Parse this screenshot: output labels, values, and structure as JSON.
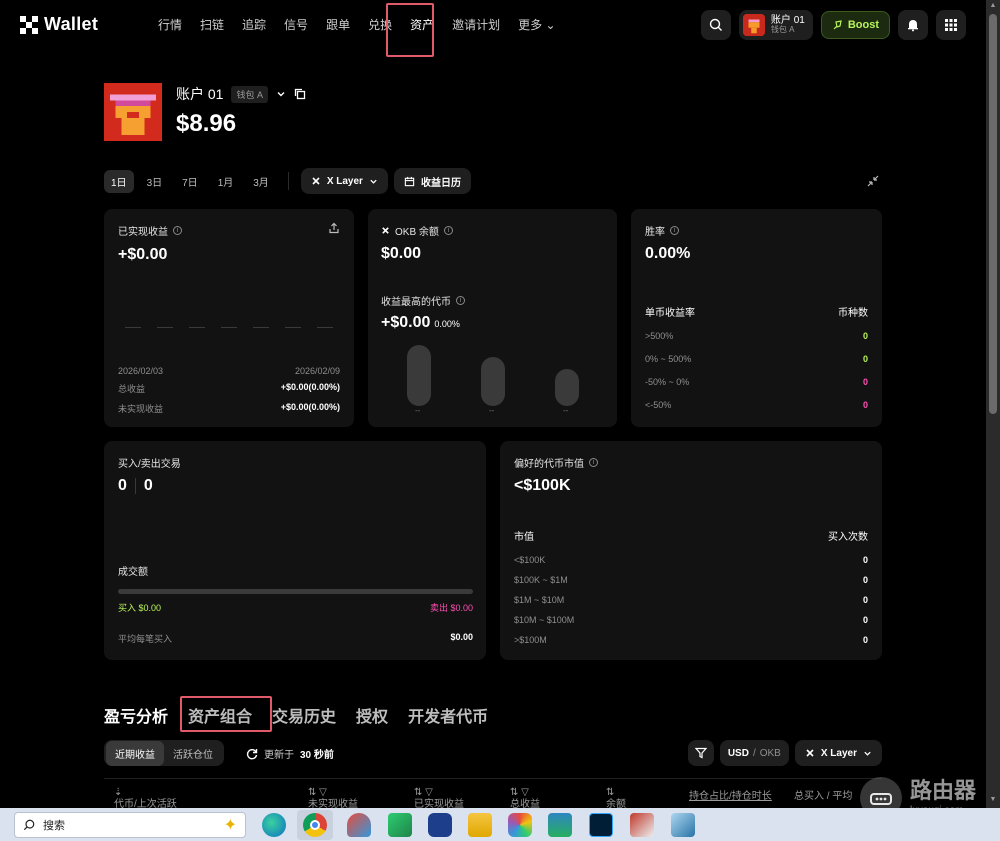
{
  "header": {
    "brand": "Wallet",
    "nav": [
      "行情",
      "扫链",
      "追踪",
      "信号",
      "跟单",
      "兑换",
      "资产",
      "邀请计划",
      "更多"
    ],
    "active_nav_index": 6,
    "account_chip": {
      "name": "账户 01",
      "wallet": "钱包 A"
    },
    "boost_label": "Boost"
  },
  "account": {
    "name": "账户 01",
    "wallet_tag": "钱包 A",
    "balance": "$8.96"
  },
  "period_row": {
    "periods": [
      "1日",
      "3日",
      "7日",
      "1月",
      "3月"
    ],
    "active_period_index": 0,
    "network": "X Layer",
    "calendar_label": "收益日历"
  },
  "cards": {
    "realized": {
      "title": "已实现收益",
      "value": "+$0.00",
      "date_start": "2026/02/03",
      "date_end": "2026/02/09",
      "total_label": "总收益",
      "total_value": "+$0.00(0.00%)",
      "unrealized_label": "未实现收益",
      "unrealized_value": "+$0.00(0.00%)"
    },
    "okb": {
      "title": "OKB 余额",
      "value": "$0.00",
      "top_title": "收益最高的代币",
      "top_value": "+$0.00",
      "top_pct": "0.00%",
      "cap_labels": [
        "--",
        "--",
        "--"
      ]
    },
    "winrate": {
      "title": "胜率",
      "value": "0.00%",
      "col_left": "单币收益率",
      "col_right": "币种数",
      "rows": [
        {
          "label": ">500%",
          "value": "0",
          "tone": "green"
        },
        {
          "label": "0% ~ 500%",
          "value": "0",
          "tone": "green"
        },
        {
          "label": "-50% ~ 0%",
          "value": "0",
          "tone": "pink"
        },
        {
          "label": "<-50%",
          "value": "0",
          "tone": "pink"
        }
      ]
    },
    "trades": {
      "title": "买入/卖出交易",
      "buy_count": "0",
      "sell_count": "0",
      "volume_label": "成交额",
      "buy_label": "买入 $0.00",
      "sell_label": "卖出 $0.00",
      "avg_label": "平均每笔买入",
      "avg_value": "$0.00"
    },
    "mcap": {
      "title": "偏好的代币市值",
      "value": "<$100K",
      "col_left": "市值",
      "col_right": "买入次数",
      "rows": [
        {
          "label": "<$100K",
          "value": "0"
        },
        {
          "label": "$100K ~ $1M",
          "value": "0"
        },
        {
          "label": "$1M ~ $10M",
          "value": "0"
        },
        {
          "label": "$10M ~ $100M",
          "value": "0"
        },
        {
          "label": ">$100M",
          "value": "0"
        }
      ]
    }
  },
  "tabs": {
    "items": [
      "盈亏分析",
      "资产组合",
      "交易历史",
      "授权",
      "开发者代币"
    ],
    "active_index": 0,
    "highlighted_index": 1
  },
  "subtabs": {
    "items": [
      "近期收益",
      "活跃仓位"
    ],
    "active_index": 0,
    "refresh_prefix": "更新于",
    "refresh_value": "30 秒前"
  },
  "table_controls": {
    "unit_active": "USD",
    "unit_inactive": "OKB",
    "network": "X Layer"
  },
  "table_header": [
    "代币/上次活跃",
    "未实现收益",
    "已实现收益",
    "总收益",
    "余额",
    "持仓占比/持仓时长",
    "总买入 / 平均"
  ],
  "taskbar": {
    "search_placeholder": "搜索"
  },
  "watermark": {
    "line1": "路由器",
    "line2": "luyouqi.com"
  },
  "colors": {
    "accent_green": "#b8f35a",
    "accent_pink": "#ff4fb3",
    "highlight_red": "#e05a6a",
    "card_bg": "#121212"
  }
}
